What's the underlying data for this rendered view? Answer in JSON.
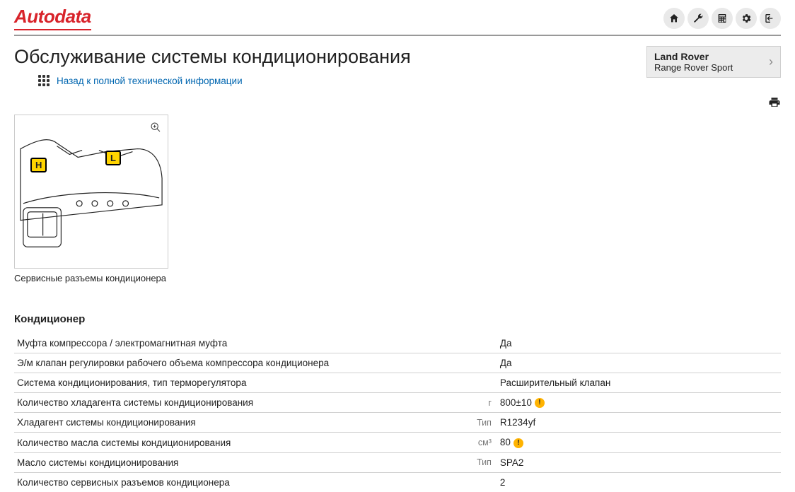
{
  "header": {
    "logo": "Autodata"
  },
  "page_title": "Обслуживание системы кондиционирования",
  "back_link": "Назад к полной технической информации",
  "vehicle": {
    "make": "Land Rover",
    "model": "Range Rover Sport"
  },
  "image": {
    "caption": "Сервисные разъемы кондиционера",
    "marker_h": "H",
    "marker_l": "L"
  },
  "section_title": "Кондиционер",
  "rows": [
    {
      "label": "Муфта компрессора / электромагнитная муфта",
      "unit": "",
      "value": "Да",
      "warn": false
    },
    {
      "label": "Э/м клапан регулировки рабочего объема компрессора кондиционера",
      "unit": "",
      "value": "Да",
      "warn": false
    },
    {
      "label": "Система кондиционирования, тип терморегулятора",
      "unit": "",
      "value": "Расширительный клапан",
      "warn": false
    },
    {
      "label": "Количество хладагента системы кондиционирования",
      "unit": "г",
      "value": "800±10",
      "warn": true
    },
    {
      "label": "Хладагент системы кондиционирования",
      "unit": "Тип",
      "value": "R1234yf",
      "warn": false
    },
    {
      "label": "Количество масла системы кондиционирования",
      "unit": "см³",
      "value": "80",
      "warn": true
    },
    {
      "label": "Масло системы кондиционирования",
      "unit": "Тип",
      "value": "SPA2",
      "warn": false
    },
    {
      "label": "Количество сервисных разъемов кондиционера",
      "unit": "",
      "value": "2",
      "warn": false
    }
  ]
}
